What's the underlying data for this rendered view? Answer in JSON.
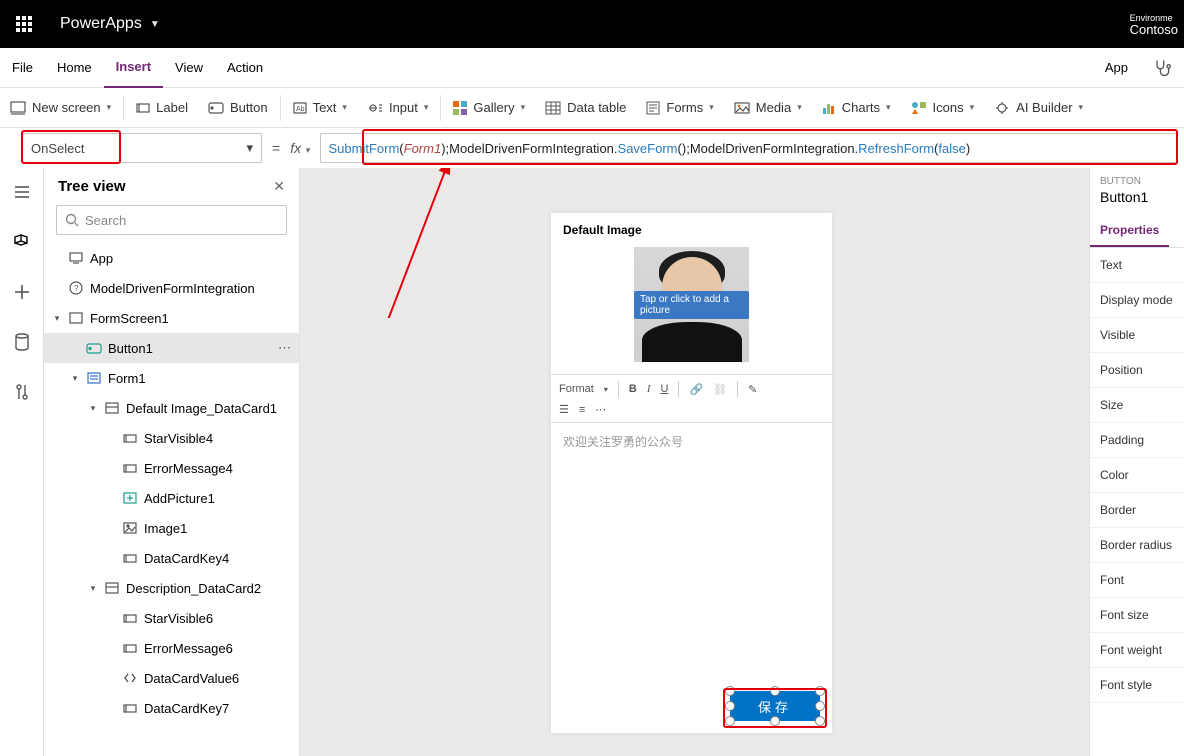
{
  "topbar": {
    "appname": "PowerApps",
    "env_label": "Environme",
    "env_name": "Contoso"
  },
  "menubar": {
    "items": [
      "File",
      "Home",
      "Insert",
      "View",
      "Action"
    ],
    "active": "Insert",
    "right": "App"
  },
  "ribbon": {
    "new_screen": "New screen",
    "label": "Label",
    "button": "Button",
    "text": "Text",
    "input": "Input",
    "gallery": "Gallery",
    "data_table": "Data table",
    "forms": "Forms",
    "media": "Media",
    "charts": "Charts",
    "icons": "Icons",
    "ai_builder": "AI Builder"
  },
  "formula": {
    "property": "OnSelect",
    "fx_label": "fx",
    "tokens": [
      "SubmitForm",
      "(",
      "Form1",
      ")",
      ";",
      "ModelDrivenFormIntegration",
      ".",
      "SaveForm",
      "(",
      ")",
      ";",
      "ModelDrivenFormIntegration",
      ".",
      "RefreshForm",
      "(",
      "false",
      ")"
    ]
  },
  "tree": {
    "title": "Tree view",
    "search_placeholder": "Search",
    "nodes": [
      {
        "label": "App",
        "depth": 0,
        "icon": "app"
      },
      {
        "label": "ModelDrivenFormIntegration",
        "depth": 0,
        "icon": "help"
      },
      {
        "label": "FormScreen1",
        "depth": 0,
        "icon": "screen",
        "expandable": true,
        "expanded": true
      },
      {
        "label": "Button1",
        "depth": 1,
        "icon": "button",
        "selected": true,
        "more": true
      },
      {
        "label": "Form1",
        "depth": 1,
        "icon": "form",
        "expandable": true,
        "expanded": true
      },
      {
        "label": "Default Image_DataCard1",
        "depth": 2,
        "icon": "card",
        "expandable": true,
        "expanded": true
      },
      {
        "label": "StarVisible4",
        "depth": 3,
        "icon": "label"
      },
      {
        "label": "ErrorMessage4",
        "depth": 3,
        "icon": "label"
      },
      {
        "label": "AddPicture1",
        "depth": 3,
        "icon": "addpic"
      },
      {
        "label": "Image1",
        "depth": 3,
        "icon": "image"
      },
      {
        "label": "DataCardKey4",
        "depth": 3,
        "icon": "label"
      },
      {
        "label": "Description_DataCard2",
        "depth": 2,
        "icon": "card",
        "expandable": true,
        "expanded": true
      },
      {
        "label": "StarVisible6",
        "depth": 3,
        "icon": "label"
      },
      {
        "label": "ErrorMessage6",
        "depth": 3,
        "icon": "label"
      },
      {
        "label": "DataCardValue6",
        "depth": 3,
        "icon": "html"
      },
      {
        "label": "DataCardKey7",
        "depth": 3,
        "icon": "label"
      }
    ]
  },
  "canvas": {
    "card_title": "Default Image",
    "picture_tip": "Tap or click to add a picture",
    "rte_format": "Format",
    "rte_text": "欢迎关注罗勇的公众号",
    "save_label": "保存"
  },
  "properties": {
    "caption": "BUTTON",
    "name": "Button1",
    "tab_properties": "Properties",
    "rows": [
      "Text",
      "Display mode",
      "Visible",
      "Position",
      "Size",
      "Padding",
      "Color",
      "Border",
      "Border radius",
      "Font",
      "Font size",
      "Font weight",
      "Font style"
    ]
  }
}
